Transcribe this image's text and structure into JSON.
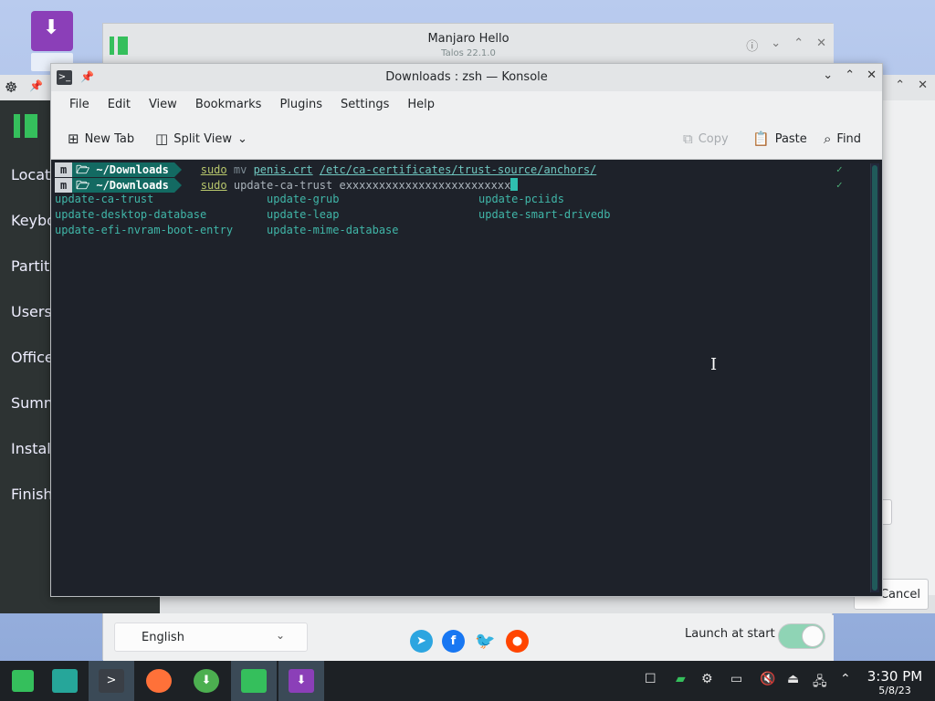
{
  "hello": {
    "title": "Manjaro Hello",
    "subtitle": "Talos 22.1.0",
    "language": "English",
    "launch_label": "Launch at start",
    "launch_enabled": true,
    "socials": [
      "telegram",
      "facebook",
      "twitter",
      "reddit"
    ]
  },
  "installer": {
    "sidebar": [
      "Locati",
      "Keybo",
      "Partiti",
      "Users",
      "Office",
      "Summ",
      "Instal",
      "Finish"
    ],
    "cancel_label": "Cancel"
  },
  "konsole": {
    "title": "Downloads : zsh — Konsole",
    "menu": [
      "File",
      "Edit",
      "View",
      "Bookmarks",
      "Plugins",
      "Settings",
      "Help"
    ],
    "toolbar": {
      "new_tab": "New Tab",
      "split_view": "Split View",
      "copy": "Copy",
      "paste": "Paste",
      "find": "Find"
    },
    "prompt_dir": "~/Downloads",
    "line1": {
      "cmd": "sudo",
      "arg1": "mv",
      "file": "penis.crt",
      "dest": "/etc/ca-certificates/trust-source/anchors/"
    },
    "line2": {
      "cmd": "sudo",
      "typed": "update-ca-trust exxxxxxxxxxxxxxxxxxxxxxxxx"
    },
    "completions": [
      [
        "update-ca-trust",
        "update-grub",
        "update-pciids"
      ],
      [
        "update-desktop-database",
        "update-leap",
        "update-smart-drivedb"
      ],
      [
        "update-efi-nvram-boot-entry",
        "update-mime-database",
        ""
      ]
    ],
    "check": "✓"
  },
  "taskbar": {
    "time": "3:30 PM",
    "date": "5/8/23"
  },
  "colors": {
    "manjaro_green": "#35bf5c",
    "terminal_bg": "#1e222a",
    "completion_teal": "#40b6a8"
  }
}
